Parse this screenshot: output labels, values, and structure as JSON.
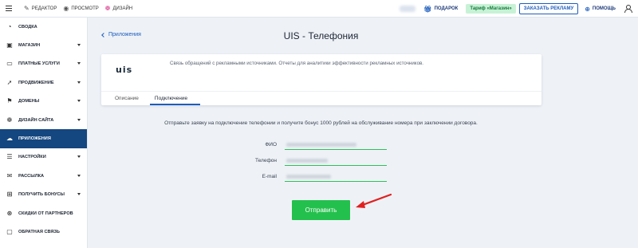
{
  "topbar": {
    "editor_label": "Редактор",
    "preview_label": "Просмотр",
    "design_label": "Дизайн",
    "gift_label": "Подарок",
    "tariff_label": "Тариф «Магазин»",
    "order_ad_label": "Заказать рекламу",
    "help_label": "Помощь"
  },
  "sidebar": {
    "items": [
      {
        "label": "Сводка",
        "icon": "gauge-icon",
        "expandable": false
      },
      {
        "label": "Магазин",
        "icon": "cart-icon",
        "expandable": true
      },
      {
        "label": "Платные услуги",
        "icon": "wallet-icon",
        "expandable": true
      },
      {
        "label": "Продвижение",
        "icon": "rocket-icon",
        "expandable": true
      },
      {
        "label": "Домены",
        "icon": "flag-icon",
        "expandable": true
      },
      {
        "label": "Дизайн сайта",
        "icon": "palette-icon",
        "expandable": true
      },
      {
        "label": "Приложения",
        "icon": "cloud-icon",
        "expandable": false,
        "active": true
      },
      {
        "label": "Настройки",
        "icon": "sliders-icon",
        "expandable": true
      },
      {
        "label": "Рассылка",
        "icon": "mail-icon",
        "expandable": true
      },
      {
        "label": "Получить бонусы",
        "icon": "gift-icon",
        "expandable": true
      },
      {
        "label": "Скидки от партнеров",
        "icon": "discount-icon",
        "expandable": false
      },
      {
        "label": "Обратная связь",
        "icon": "chat-icon",
        "expandable": false
      }
    ]
  },
  "main": {
    "back_label": "Приложения",
    "title": "UIS - Телефония",
    "card": {
      "logo_text": "uis",
      "description": "Связь обращений с рекламными источниками. Отчеты для аналитики эффективности рекламных источников.",
      "tabs": [
        {
          "label": "Описание",
          "active": false
        },
        {
          "label": "Подключение",
          "active": true
        }
      ]
    },
    "promo_text": "Отправьте заявку на подключение телефонии и получите бонус 1000 рублей на обслуживание номера при заключении договора.",
    "form": {
      "fio_label": "ФИО",
      "phone_label": "Телефон",
      "email_label": "E-mail"
    },
    "submit_label": "Отправить"
  },
  "colors": {
    "accent_blue": "#1d5dbd",
    "sidebar_active": "#14467f",
    "submit_green": "#24c04d",
    "annotation_red": "#e0201f"
  }
}
